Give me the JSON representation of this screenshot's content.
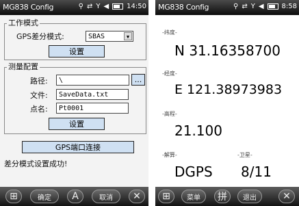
{
  "left": {
    "title": "MG838 Config",
    "clock": "14:50",
    "work_mode": {
      "legend": "工作模式",
      "gps_mode_label": "GPS差分模式:",
      "gps_mode_value": "SBAS",
      "set_button": "设置"
    },
    "measure": {
      "legend": "测量配置",
      "path_label": "路径:",
      "path_value": "\\",
      "browse_button": "...",
      "file_label": "文件:",
      "file_value": "SaveData.txt",
      "point_label": "点名:",
      "point_value": "Pt0001",
      "set_button": "设置"
    },
    "port_button": "GPS端口连接",
    "status": "差分模式设置成功!",
    "softkeys": {
      "ok": "确定",
      "cancel": "取消",
      "input": "A",
      "close": "✕"
    }
  },
  "right": {
    "title": "MG838 Config",
    "clock": "8:58",
    "lat_label": "-纬度-",
    "lat_value": "N 31.16358700",
    "lon_label": "-经度-",
    "lon_value": "E 121.38973983",
    "alt_label": "-高程-",
    "alt_value": "21.100",
    "sol_label": "-解算-",
    "sol_value": "DGPS",
    "sat_label": "-卫星-",
    "sat_value": "8/11",
    "softkeys": {
      "left": "菜单",
      "mid": "拼",
      "right": "退出",
      "close": "✕"
    }
  }
}
